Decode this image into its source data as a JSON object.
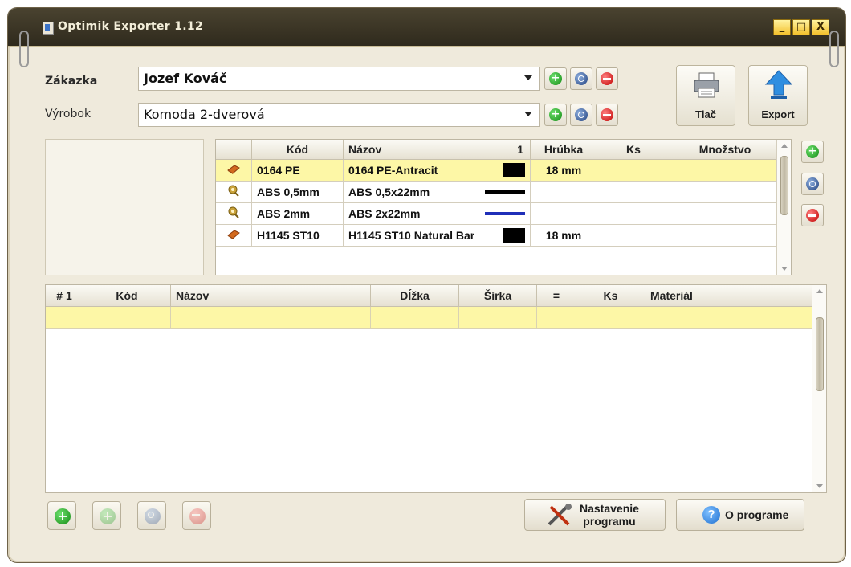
{
  "window": {
    "title": "Optimik Exporter 1.12",
    "controls": [
      "_",
      "□",
      "X"
    ]
  },
  "order": {
    "label": "Zákazka",
    "value": "Jozef Kováč"
  },
  "product": {
    "label": "Výrobok",
    "value": "Komoda 2-dverová"
  },
  "toolbar": {
    "print_label": "Tlač",
    "export_label": "Export"
  },
  "materials": {
    "columns": [
      "",
      "Kód",
      "Názov",
      "1",
      "Hrúbka",
      "Ks",
      "Množstvo"
    ],
    "rows": [
      {
        "icon": "board-icon",
        "code": "0164 PE",
        "name": "0164 PE-Antracit",
        "swatch": "#000000",
        "thickness": "18 mm",
        "qty": "",
        "amount": ""
      },
      {
        "icon": "edge-tape-icon",
        "code": "ABS 0,5mm",
        "name": "ABS 0,5x22mm",
        "swatch": "#000000",
        "thickness": "",
        "qty": "",
        "amount": ""
      },
      {
        "icon": "edge-tape-icon",
        "code": "ABS 2mm",
        "name": "ABS 2x22mm",
        "swatch": "#1f2fb8",
        "thickness": "",
        "qty": "",
        "amount": ""
      },
      {
        "icon": "board-icon",
        "code": "H1145 ST10",
        "name": "H1145 ST10 Natural Bar",
        "swatch": "#000000",
        "thickness": "18 mm",
        "qty": "",
        "amount": ""
      }
    ]
  },
  "parts": {
    "columns": [
      "# 1",
      "Kód",
      "Názov",
      "Dĺžka",
      "Šírka",
      "=",
      "Ks",
      "Materiál"
    ]
  },
  "footer": {
    "settings_label_1": "Nastavenie",
    "settings_label_2": "programu",
    "about_label": "O programe"
  }
}
